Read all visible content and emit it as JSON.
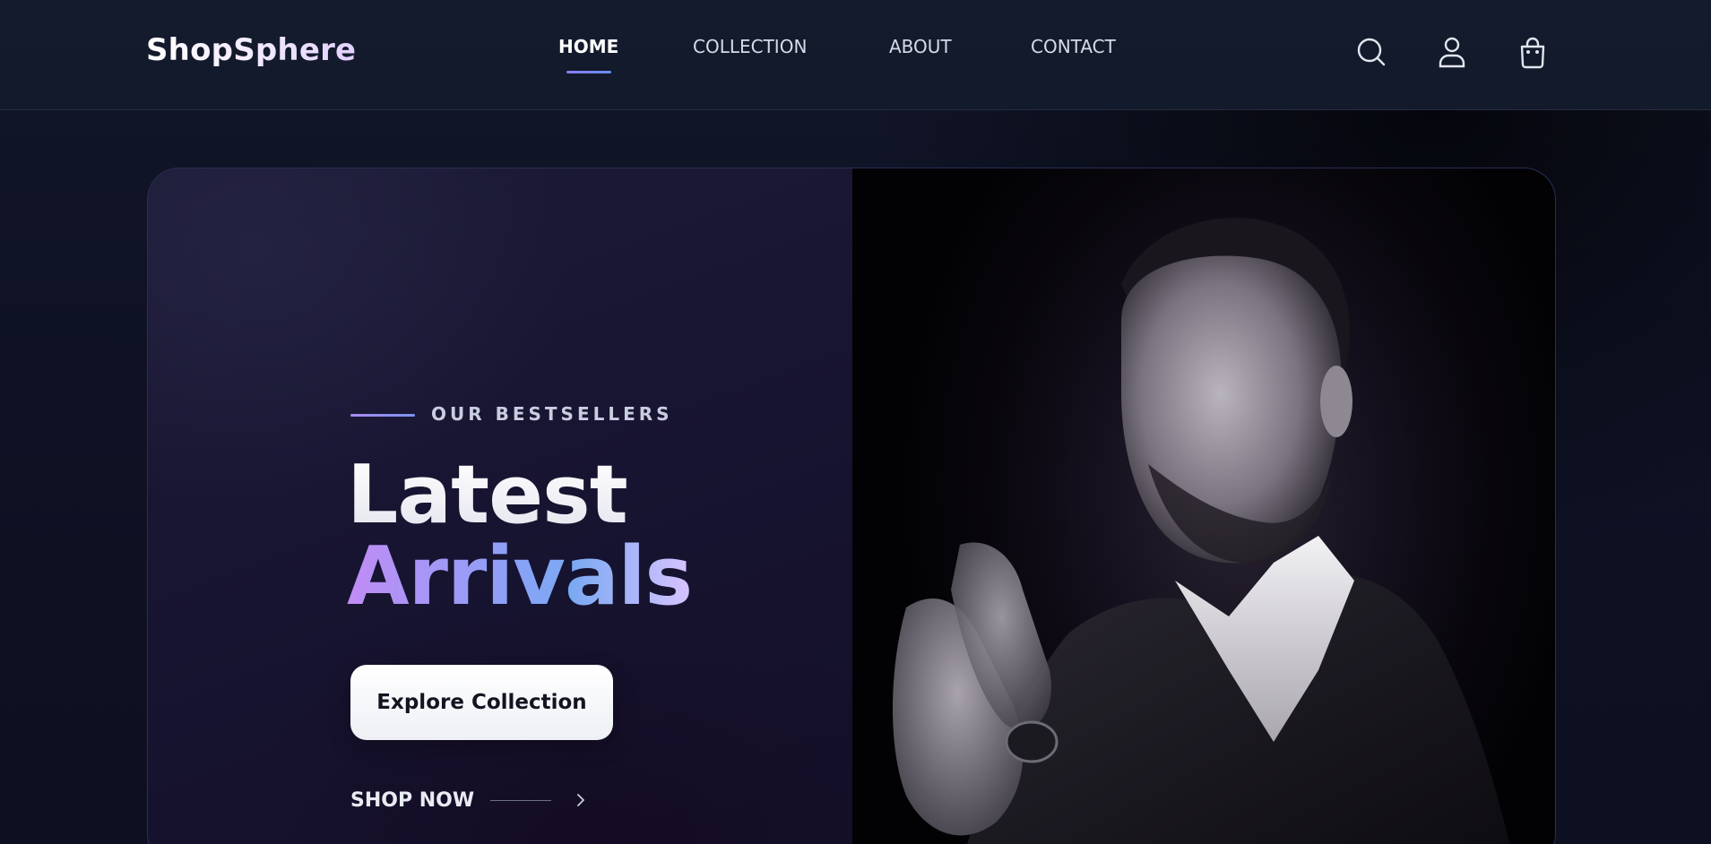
{
  "brand": {
    "name": "ShopSphere"
  },
  "nav": {
    "items": [
      {
        "label": "HOME",
        "active": true
      },
      {
        "label": "COLLECTION",
        "active": false
      },
      {
        "label": "ABOUT",
        "active": false
      },
      {
        "label": "CONTACT",
        "active": false
      }
    ],
    "accent_color": "#8c7cf6"
  },
  "header_icons": [
    "search-icon",
    "user-icon",
    "shopping-bag-icon"
  ],
  "hero": {
    "eyebrow": "OUR BESTSELLERS",
    "title_line1": "Latest",
    "title_line2": "Arrivals",
    "cta_label": "Explore Collection",
    "secondary_link": "SHOP NOW",
    "image_description_icon": "model-photo"
  },
  "colors": {
    "background": "#0f1423",
    "header": "#141b2d",
    "gradient_start": "#c08cf5",
    "gradient_end": "#7aa9f3"
  }
}
